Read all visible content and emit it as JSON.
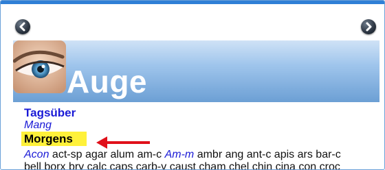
{
  "page": {
    "title": "Auge"
  },
  "nav": {
    "prev_icon": "chevron-left-icon",
    "next_icon": "chevron-right-icon"
  },
  "sections": {
    "tagsueber": {
      "heading": "Tagsüber",
      "remedies": [
        "Mang"
      ]
    },
    "morgens": {
      "heading": "Morgens",
      "remedies_line1": [
        {
          "text": "Acon",
          "italic": true
        },
        {
          "text": "act-sp",
          "italic": false
        },
        {
          "text": "agar",
          "italic": false
        },
        {
          "text": "alum",
          "italic": false
        },
        {
          "text": "am-c",
          "italic": false
        },
        {
          "text": "Am-m",
          "italic": true
        },
        {
          "text": "ambr",
          "italic": false
        },
        {
          "text": "ang",
          "italic": false
        },
        {
          "text": "ant-c",
          "italic": false
        },
        {
          "text": "apis",
          "italic": false
        },
        {
          "text": "ars",
          "italic": false
        },
        {
          "text": "bar-c",
          "italic": false
        }
      ],
      "remedies_line2": [
        {
          "text": "bell",
          "italic": false
        },
        {
          "text": "borx",
          "italic": false
        },
        {
          "text": "bry",
          "italic": false
        },
        {
          "text": "calc",
          "italic": false
        },
        {
          "text": "caps",
          "italic": false
        },
        {
          "text": "carb-v",
          "italic": false
        },
        {
          "text": "caust",
          "italic": false
        },
        {
          "text": "cham",
          "italic": false
        },
        {
          "text": "chel",
          "italic": false
        },
        {
          "text": "chin",
          "italic": false
        },
        {
          "text": "cina",
          "italic": false
        },
        {
          "text": "con",
          "italic": false
        },
        {
          "text": "croc",
          "italic": false
        }
      ]
    }
  },
  "colors": {
    "accent_blue": "#1a1ad6",
    "highlight_yellow": "#fff13a",
    "arrow_red": "#e0101a",
    "banner_blue": "#6c9fd4"
  }
}
